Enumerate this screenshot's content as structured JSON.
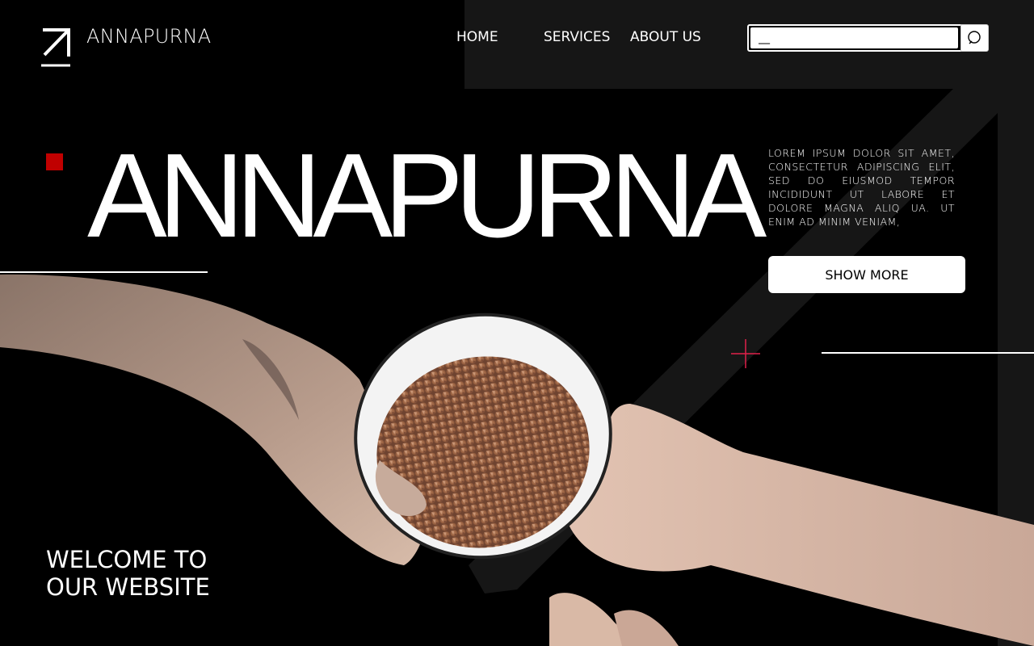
{
  "header": {
    "brand": "ANNAPURNA",
    "nav": [
      {
        "label": "HOME"
      },
      {
        "label": "SERVICES"
      },
      {
        "label": "ABOUT US"
      }
    ],
    "search": {
      "value": "__",
      "placeholder": ""
    },
    "logo_icon": "arrow-up-right-icon",
    "search_icon": "search-icon"
  },
  "hero": {
    "title": "ANNAPURNA",
    "description": "LOREM IPSUM DOLOR SIT AMET, CONSECTETUR ADIPISCING ELIT, SED DO EIUSMOD TEMPOR INCIDIDUNT UT LABORE ET DOLORE MAGNA ALIQ UA. UT ENIM AD MINIM VENIAM,",
    "button_label": "SHOW MORE",
    "welcome_line1": "WELCOME TO",
    "welcome_line2": "OUR WEBSITE"
  },
  "colors": {
    "background": "#000000",
    "foreground": "#ffffff",
    "accent_red": "#c00000",
    "plus_pink": "#e0204a"
  }
}
